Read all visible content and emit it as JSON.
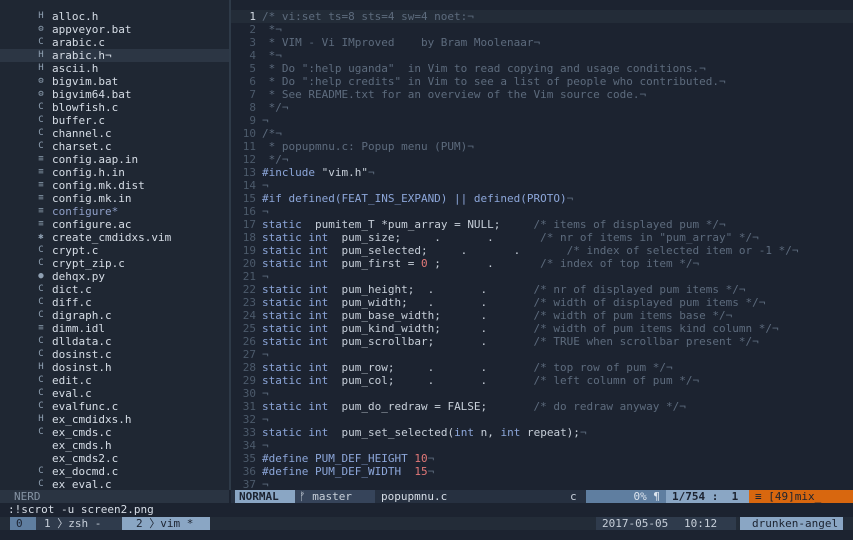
{
  "tree": {
    "status": "NERD",
    "files": [
      {
        "icon": "H",
        "name": "alloc.h"
      },
      {
        "icon": "⚙",
        "name": "appveyor.bat"
      },
      {
        "icon": "C",
        "name": "arabic.c"
      },
      {
        "icon": "H",
        "name": "arabic.h¬"
      },
      {
        "icon": "H",
        "name": "ascii.h"
      },
      {
        "icon": "⚙",
        "name": "bigvim.bat"
      },
      {
        "icon": "⚙",
        "name": "bigvim64.bat"
      },
      {
        "icon": "C",
        "name": "blowfish.c"
      },
      {
        "icon": "C",
        "name": "buffer.c"
      },
      {
        "icon": "C",
        "name": "channel.c"
      },
      {
        "icon": "C",
        "name": "charset.c"
      },
      {
        "icon": "≡",
        "name": "config.aap.in"
      },
      {
        "icon": "≡",
        "name": "config.h.in"
      },
      {
        "icon": "≡",
        "name": "config.mk.dist"
      },
      {
        "icon": "≡",
        "name": "config.mk.in"
      },
      {
        "icon": "≡",
        "name": "configure*"
      },
      {
        "icon": "≡",
        "name": "configure.ac"
      },
      {
        "icon": "✱",
        "name": "create_cmdidxs.vim"
      },
      {
        "icon": "C",
        "name": "crypt.c"
      },
      {
        "icon": "C",
        "name": "crypt_zip.c"
      },
      {
        "icon": "●",
        "name": "dehqx.py"
      },
      {
        "icon": "C",
        "name": "dict.c"
      },
      {
        "icon": "C",
        "name": "diff.c"
      },
      {
        "icon": "C",
        "name": "digraph.c"
      },
      {
        "icon": "≡",
        "name": "dimm.idl"
      },
      {
        "icon": "C",
        "name": "dlldata.c"
      },
      {
        "icon": "C",
        "name": "dosinst.c"
      },
      {
        "icon": "H",
        "name": "dosinst.h"
      },
      {
        "icon": "C",
        "name": "edit.c"
      },
      {
        "icon": "C",
        "name": "eval.c"
      },
      {
        "icon": "C",
        "name": "evalfunc.c"
      },
      {
        "icon": "H",
        "name": "ex_cmdidxs.h"
      },
      {
        "icon": "C",
        "name": "ex_cmds.c"
      },
      {
        "icon": "",
        "name": "ex_cmds.h"
      },
      {
        "icon": "",
        "name": "ex_cmds2.c"
      },
      {
        "icon": "C",
        "name": "ex_docmd.c"
      },
      {
        "icon": "C",
        "name": "ex_eval.c"
      }
    ]
  },
  "editor": {
    "lines": [
      {
        "n": "1",
        "segs": [
          [
            "cmt",
            "/* vi:set ts=8 sts=4 sw=4 noet:¬"
          ]
        ]
      },
      {
        "n": "2",
        "segs": [
          [
            "cmt",
            " *¬"
          ]
        ]
      },
      {
        "n": "3",
        "segs": [
          [
            "cmt",
            " * VIM - Vi IMproved    by Bram Moolenaar¬"
          ]
        ]
      },
      {
        "n": "4",
        "segs": [
          [
            "cmt",
            " *¬"
          ]
        ]
      },
      {
        "n": "5",
        "segs": [
          [
            "cmt",
            " * Do \":help uganda\"  in Vim to read copying and usage conditions.¬"
          ]
        ]
      },
      {
        "n": "6",
        "segs": [
          [
            "cmt",
            " * Do \":help credits\" in Vim to see a list of people who contributed.¬"
          ]
        ]
      },
      {
        "n": "7",
        "segs": [
          [
            "cmt",
            " * See README.txt for an overview of the Vim source code.¬"
          ]
        ]
      },
      {
        "n": "8",
        "segs": [
          [
            "cmt",
            " */¬"
          ]
        ]
      },
      {
        "n": "9",
        "segs": [
          [
            "cmt",
            "¬"
          ]
        ]
      },
      {
        "n": "10",
        "segs": [
          [
            "cmt",
            "/*¬"
          ]
        ]
      },
      {
        "n": "11",
        "segs": [
          [
            "cmt",
            " * popupmnu.c: Popup menu (PUM)¬"
          ]
        ]
      },
      {
        "n": "12",
        "segs": [
          [
            "cmt",
            " */¬"
          ]
        ]
      },
      {
        "n": "13",
        "segs": [
          [
            "pp",
            "#include "
          ],
          [
            "str",
            "\"vim.h\""
          ],
          [
            "cmt",
            "¬"
          ]
        ]
      },
      {
        "n": "14",
        "segs": [
          [
            "cmt",
            "¬"
          ]
        ]
      },
      {
        "n": "15",
        "segs": [
          [
            "pp",
            "#if defined(FEAT_INS_EXPAND) || defined(PROTO)"
          ],
          [
            "cmt",
            "¬"
          ]
        ]
      },
      {
        "n": "16",
        "segs": [
          [
            "cmt",
            "¬"
          ]
        ]
      },
      {
        "n": "17",
        "segs": [
          [
            "kw",
            "static"
          ],
          [
            "",
            "  pumitem_T *pum_array = NULL;     "
          ],
          [
            "cmt",
            "/* items of displayed pum */¬"
          ]
        ]
      },
      {
        "n": "18",
        "segs": [
          [
            "kw",
            "static int"
          ],
          [
            "",
            "  pum_size;     .       .       "
          ],
          [
            "cmt",
            "/* nr of items in \"pum_array\" */¬"
          ]
        ]
      },
      {
        "n": "19",
        "segs": [
          [
            "kw",
            "static int"
          ],
          [
            "",
            "  pum_selected;     .       .       "
          ],
          [
            "cmt",
            "/* index of selected item or -1 */¬"
          ]
        ]
      },
      {
        "n": "20",
        "segs": [
          [
            "kw",
            "static int"
          ],
          [
            "",
            "  pum_first = "
          ],
          [
            "num",
            "0"
          ],
          [
            "",
            " ;       .       "
          ],
          [
            "cmt",
            "/* index of top item */¬"
          ]
        ]
      },
      {
        "n": "21",
        "segs": [
          [
            "cmt",
            "¬"
          ]
        ]
      },
      {
        "n": "22",
        "segs": [
          [
            "kw",
            "static int"
          ],
          [
            "",
            "  pum_height;  .       .       "
          ],
          [
            "cmt",
            "/* nr of displayed pum items */¬"
          ]
        ]
      },
      {
        "n": "23",
        "segs": [
          [
            "kw",
            "static int"
          ],
          [
            "",
            "  pum_width;   .       .       "
          ],
          [
            "cmt",
            "/* width of displayed pum items */¬"
          ]
        ]
      },
      {
        "n": "24",
        "segs": [
          [
            "kw",
            "static int"
          ],
          [
            "",
            "  pum_base_width;      .       "
          ],
          [
            "cmt",
            "/* width of pum items base */¬"
          ]
        ]
      },
      {
        "n": "25",
        "segs": [
          [
            "kw",
            "static int"
          ],
          [
            "",
            "  pum_kind_width;      .       "
          ],
          [
            "cmt",
            "/* width of pum items kind column */¬"
          ]
        ]
      },
      {
        "n": "26",
        "segs": [
          [
            "kw",
            "static int"
          ],
          [
            "",
            "  pum_scrollbar;       .       "
          ],
          [
            "cmt",
            "/* TRUE when scrollbar present */¬"
          ]
        ]
      },
      {
        "n": "27",
        "segs": [
          [
            "cmt",
            "¬"
          ]
        ]
      },
      {
        "n": "28",
        "segs": [
          [
            "kw",
            "static int"
          ],
          [
            "",
            "  pum_row;     .       .       "
          ],
          [
            "cmt",
            "/* top row of pum */¬"
          ]
        ]
      },
      {
        "n": "29",
        "segs": [
          [
            "kw",
            "static int"
          ],
          [
            "",
            "  pum_col;     .       .       "
          ],
          [
            "cmt",
            "/* left column of pum */¬"
          ]
        ]
      },
      {
        "n": "30",
        "segs": [
          [
            "cmt",
            "¬"
          ]
        ]
      },
      {
        "n": "31",
        "segs": [
          [
            "kw",
            "static int"
          ],
          [
            "",
            "  pum_do_redraw = FALSE;       "
          ],
          [
            "cmt",
            "/* do redraw anyway */¬"
          ]
        ]
      },
      {
        "n": "32",
        "segs": [
          [
            "cmt",
            "¬"
          ]
        ]
      },
      {
        "n": "33",
        "segs": [
          [
            "kw",
            "static int"
          ],
          [
            "",
            "  pum_set_selected("
          ],
          [
            "kw",
            "int"
          ],
          [
            "",
            " n, "
          ],
          [
            "kw",
            "int"
          ],
          [
            "",
            " repeat);"
          ],
          [
            "cmt",
            "¬"
          ]
        ]
      },
      {
        "n": "34",
        "segs": [
          [
            "cmt",
            "¬"
          ]
        ]
      },
      {
        "n": "35",
        "segs": [
          [
            "pp",
            "#define PUM_DEF_HEIGHT "
          ],
          [
            "num",
            "10"
          ],
          [
            "cmt",
            "¬"
          ]
        ]
      },
      {
        "n": "36",
        "segs": [
          [
            "pp",
            "#define PUM_DEF_WIDTH  "
          ],
          [
            "num",
            "15"
          ],
          [
            "cmt",
            "¬"
          ]
        ]
      },
      {
        "n": "37",
        "segs": [
          [
            "cmt",
            "¬"
          ]
        ]
      }
    ]
  },
  "statusline": {
    "mode": "NORMAL",
    "branch_icon": "ᚠ",
    "branch": "master",
    "filename": "popupmnu.c",
    "filetype": "c",
    "percent": "0%",
    "ln_icon": "¶",
    "position": "1/754 :  1",
    "warning": "≡ [49]mix_"
  },
  "cmdline": ":!scrot -u screen2.png",
  "tmux": {
    "session": "0",
    "window1": "1 〉zsh -",
    "window2": "2 〉vim *",
    "date": "2017-05-05",
    "time": "10:12",
    "host": "drunken-angel"
  }
}
